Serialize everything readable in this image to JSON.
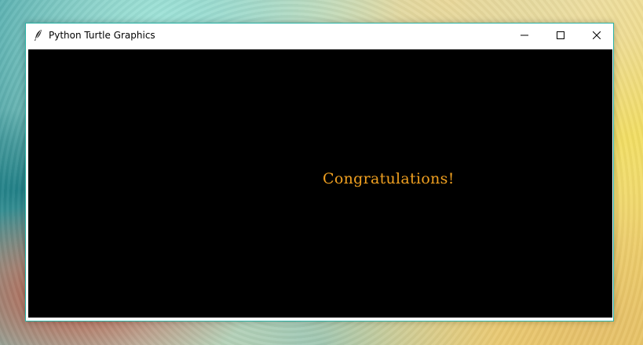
{
  "window": {
    "title": "Python Turtle Graphics",
    "icon": "feather-icon"
  },
  "controls": {
    "minimize_icon": "minimize-icon",
    "maximize_icon": "maximize-icon",
    "close_icon": "close-icon"
  },
  "canvas": {
    "background": "#000000",
    "message": "Congratulations!",
    "message_color": "#f0a020"
  },
  "colors": {
    "window_border": "#2bb3a6"
  }
}
